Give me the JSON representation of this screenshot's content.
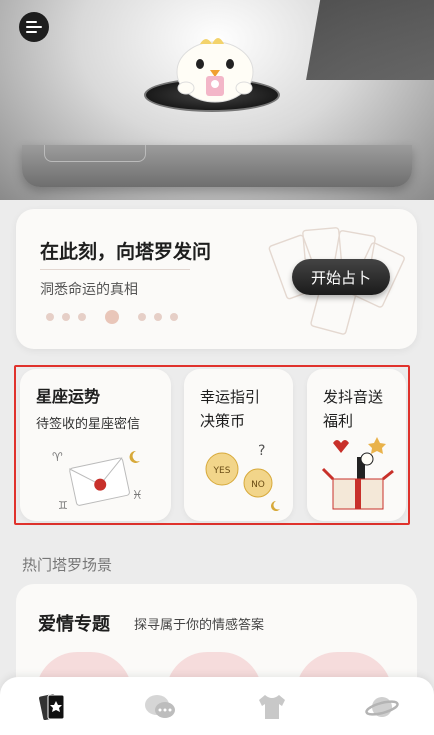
{
  "hero": {
    "title": "在此刻，向塔罗发问",
    "subtitle": "洞悉命运的真相",
    "start_button": "开始占卜"
  },
  "features": [
    {
      "title": "星座运势",
      "subtitle": "待签收的星座密信"
    },
    {
      "title": "幸运指引\n决策币"
    },
    {
      "title": "发抖音送\n福利"
    }
  ],
  "coin_labels": {
    "yes": "YES",
    "no": "NO"
  },
  "sections": {
    "hot_title": "热门塔罗场景"
  },
  "love_topic": {
    "title": "爱情专题",
    "subtitle": "探寻属于你的情感答案"
  },
  "tabbar": {
    "items": [
      {
        "icon": "tarot-cards-icon",
        "active": true
      },
      {
        "icon": "chat-bubbles-icon",
        "active": false
      },
      {
        "icon": "tshirt-icon",
        "active": false
      },
      {
        "icon": "planet-icon",
        "active": false
      }
    ]
  },
  "colors": {
    "highlight_border": "#e0322c",
    "accent_red": "#c8302a",
    "gold": "#d7a93a",
    "card_bg": "#fbfaf8",
    "dark_button": "#1b1b1b"
  }
}
